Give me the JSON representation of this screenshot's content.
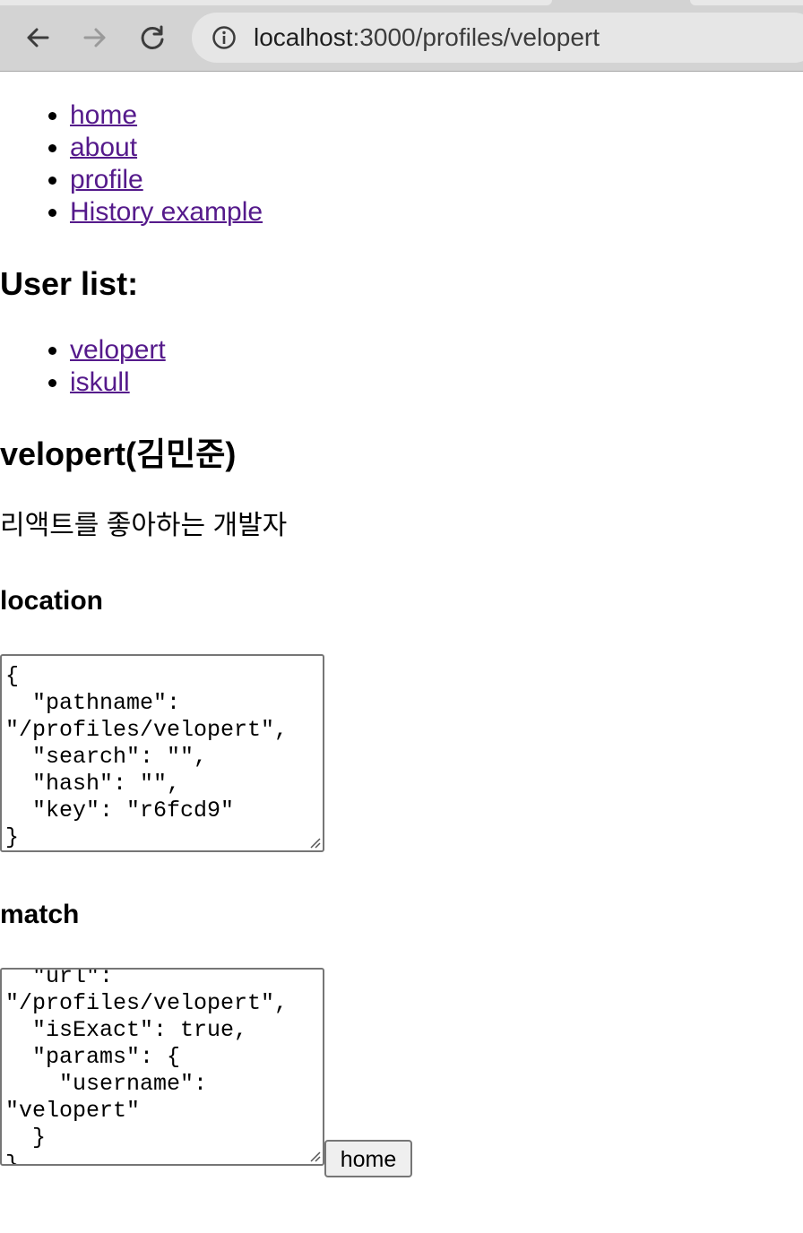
{
  "browser": {
    "url_host": "localhost",
    "url_rest": ":3000/profiles/velopert"
  },
  "nav": {
    "items": [
      {
        "label": "home"
      },
      {
        "label": "about"
      },
      {
        "label": "profile"
      },
      {
        "label": "History example"
      }
    ]
  },
  "user_list": {
    "heading": "User list:",
    "items": [
      {
        "label": "velopert"
      },
      {
        "label": "iskull"
      }
    ]
  },
  "profile": {
    "name": "velopert(김민준)",
    "description": "리액트를 좋아하는 개발자"
  },
  "location_section": {
    "heading": "location",
    "value": "{\n  \"pathname\": \"/profiles/velopert\",\n  \"search\": \"\",\n  \"hash\": \"\",\n  \"key\": \"r6fcd9\"\n}"
  },
  "match_section": {
    "heading": "match",
    "value": "  \"url\": \"/profiles/velopert\",\n  \"isExact\": true,\n  \"params\": {\n    \"username\": \"velopert\"\n  }\n}"
  },
  "home_button": {
    "label": "home"
  },
  "colors": {
    "link": "#551a8b",
    "chrome_bg": "#d3d3d3",
    "omnibox_bg": "#e6e6e6"
  }
}
